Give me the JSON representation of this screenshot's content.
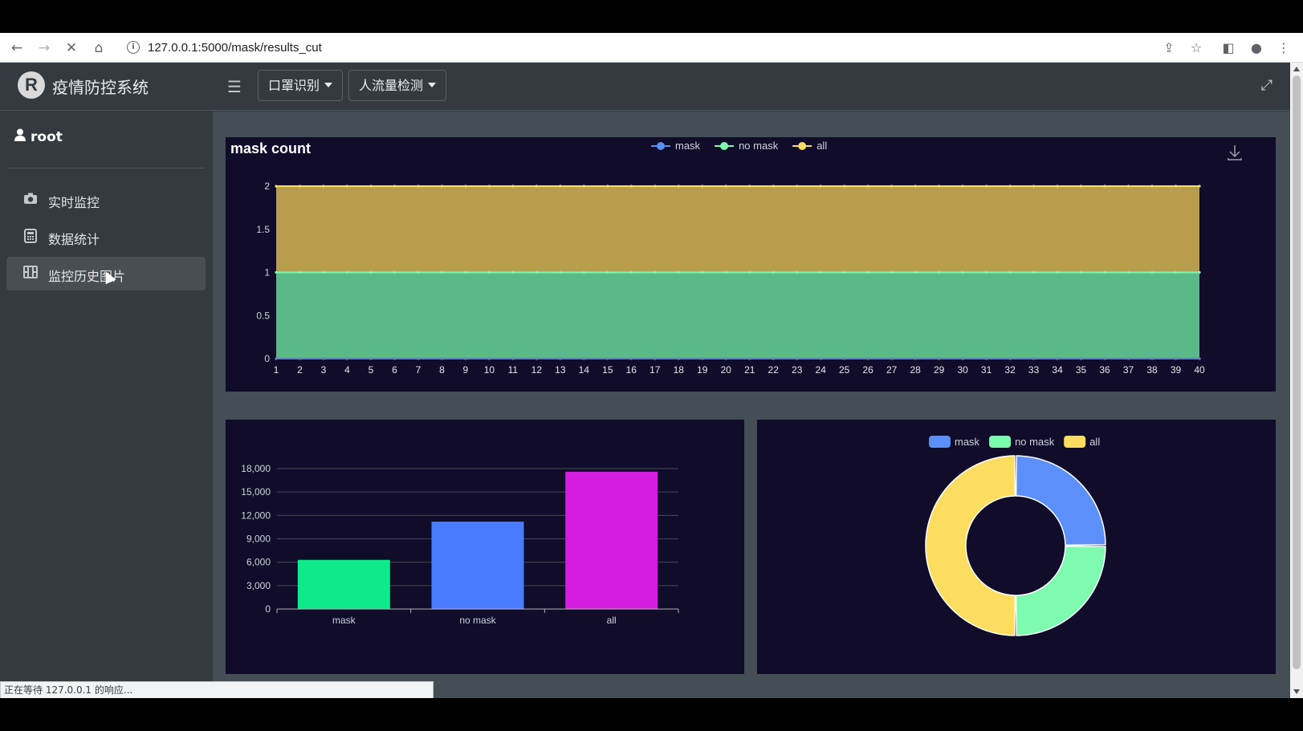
{
  "browser": {
    "url": "127.0.0.1:5000/mask/results_cut",
    "status_text": "正在等待 127.0.0.1 的响应..."
  },
  "app": {
    "brand_title": "疫情防控系统",
    "brand_logo_letter": "R",
    "user_name": "root",
    "menu": [
      {
        "label": "实时监控",
        "icon": "camera-icon",
        "active": false
      },
      {
        "label": "数据统计",
        "icon": "calculator-icon",
        "active": false
      },
      {
        "label": "监控历史图片",
        "icon": "film-icon",
        "active": true
      }
    ],
    "topnav": {
      "dropdown1": "口罩识别",
      "dropdown2": "人流量检测"
    }
  },
  "chart_data": [
    {
      "type": "area",
      "title": "mask count",
      "legend": [
        "mask",
        "no mask",
        "all"
      ],
      "x": [
        1,
        2,
        3,
        4,
        5,
        6,
        7,
        8,
        9,
        10,
        11,
        12,
        13,
        14,
        15,
        16,
        17,
        18,
        19,
        20,
        21,
        22,
        23,
        24,
        25,
        26,
        27,
        28,
        29,
        30,
        31,
        32,
        33,
        34,
        35,
        36,
        37,
        38,
        39,
        40
      ],
      "series": [
        {
          "name": "mask",
          "color": "#5470c6",
          "values": [
            0,
            0,
            0,
            0,
            0,
            0,
            0,
            0,
            0,
            0,
            0,
            0,
            0,
            0,
            0,
            0,
            0,
            0,
            0,
            0,
            0,
            0,
            0,
            0,
            0,
            0,
            0,
            0,
            0,
            0,
            0,
            0,
            0,
            0,
            0,
            0,
            0,
            0,
            0,
            0
          ]
        },
        {
          "name": "no mask",
          "color": "#91cc75",
          "values": [
            1,
            1,
            1,
            1,
            1,
            1,
            1,
            1,
            1,
            1,
            1,
            1,
            1,
            1,
            1,
            1,
            1,
            1,
            1,
            1,
            1,
            1,
            1,
            1,
            1,
            1,
            1,
            1,
            1,
            1,
            1,
            1,
            1,
            1,
            1,
            1,
            1,
            1,
            1,
            1
          ]
        },
        {
          "name": "all",
          "color": "#fac858",
          "values": [
            2,
            2,
            2,
            2,
            2,
            2,
            2,
            2,
            2,
            2,
            2,
            2,
            2,
            2,
            2,
            2,
            2,
            2,
            2,
            2,
            2,
            2,
            2,
            2,
            2,
            2,
            2,
            2,
            2,
            2,
            2,
            2,
            2,
            2,
            2,
            2,
            2,
            2,
            2,
            2
          ]
        }
      ],
      "yticks": [
        "0",
        "0.5",
        "1",
        "1.5",
        "2"
      ],
      "ylim": [
        0,
        2
      ],
      "grid": false,
      "legend_placement": "top-center"
    },
    {
      "type": "bar",
      "categories": [
        "mask",
        "no mask",
        "all"
      ],
      "values": [
        6300,
        11200,
        17600
      ],
      "colors": [
        "#10e98b",
        "#4a7cff",
        "#d31ee0"
      ],
      "yticks": [
        "0",
        "3,000",
        "6,000",
        "9,000",
        "12,000",
        "15,000",
        "18,000"
      ],
      "ylim": [
        0,
        18000
      ],
      "grid": true
    },
    {
      "type": "pie",
      "legend": [
        "mask",
        "no mask",
        "all"
      ],
      "values": [
        1,
        1,
        2
      ],
      "colors": [
        "#5b8ff9",
        "#7dfcb0",
        "#fddd60"
      ],
      "donut": true,
      "legend_placement": "top-center"
    }
  ]
}
